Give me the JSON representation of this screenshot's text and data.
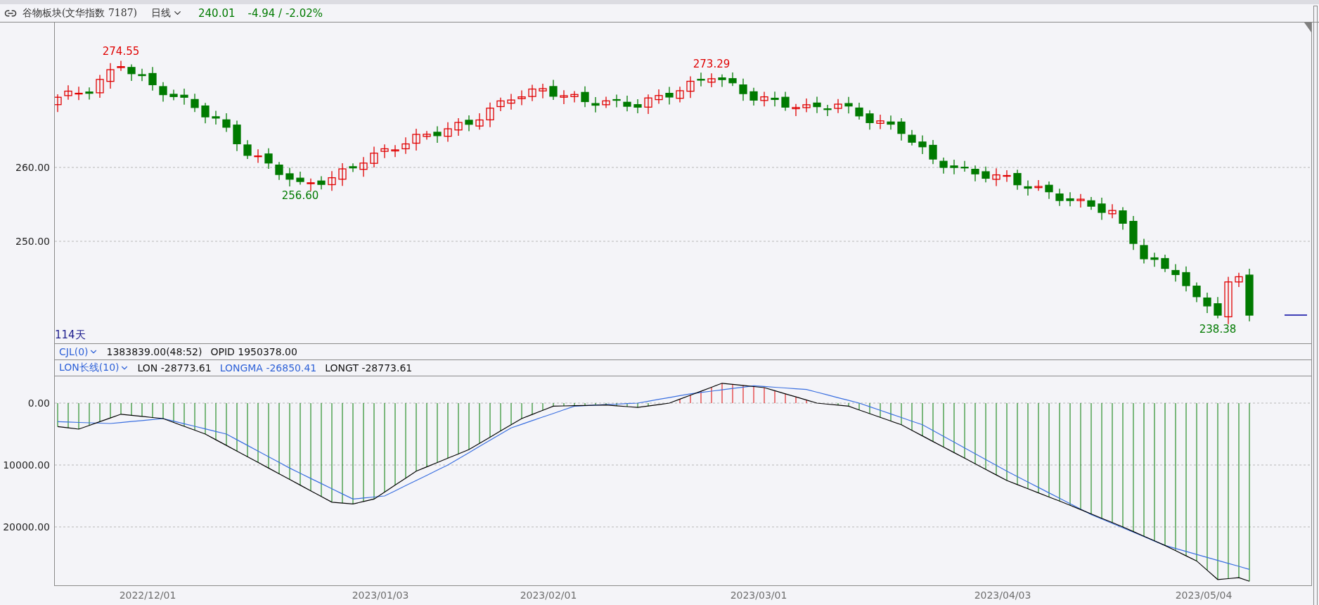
{
  "header": {
    "title": "谷物板块(文华指数  7187)",
    "period": "日线",
    "price": "240.01",
    "change": "-4.94 / -2.02%"
  },
  "main_pane": {
    "yticks": [
      "260.00",
      "250.00"
    ],
    "marks": [
      {
        "label": "274.55",
        "kind": "high"
      },
      {
        "label": "256.60",
        "kind": "low"
      },
      {
        "label": "273.29",
        "kind": "high"
      },
      {
        "label": "238.38",
        "kind": "low"
      }
    ],
    "days": "114天"
  },
  "volume_bar": {
    "indicator": "CJL(0)",
    "values": "1383839.00(48:52)",
    "opid": "OPID 1950378.00"
  },
  "lon_pane": {
    "indicator": "LON长线(10)",
    "lon": "LON -28773.61",
    "longma": "LONGMA -26850.41",
    "longt": "LONGT -28773.61",
    "yticks": [
      "0.00",
      "10000.00",
      "20000.00"
    ]
  },
  "dates": [
    "2022/12/01",
    "2023/01/03",
    "2023/02/01",
    "2023/03/01",
    "2023/04/03",
    "2023/05/04"
  ]
}
